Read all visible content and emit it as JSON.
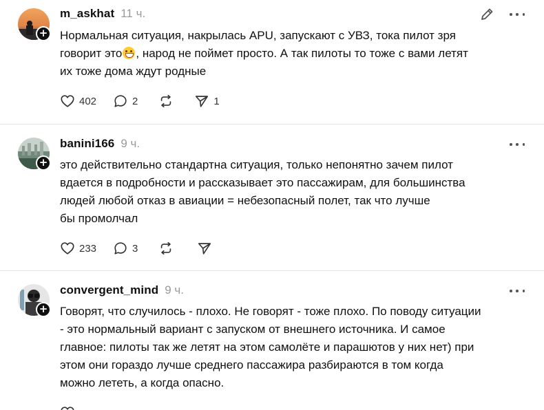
{
  "posts": [
    {
      "username": "m_askhat",
      "time": "11 ч.",
      "lines": [
        "Нормальная ситуация, накрылась APU, запускают с УВЗ, тока пилот зря",
        "говорит это",
        ", народ не поймет просто. А так пилоты то тоже с вами летят",
        "их тоже дома ждут родные"
      ],
      "likes": "402",
      "replies": "2",
      "reposts": "",
      "shares": "1"
    },
    {
      "username": "banini166",
      "time": "9 ч.",
      "lines": [
        "это действительно стандартна ситуация, только непонятно зачем пилот",
        "вдается в подробности и рассказывает это пассажирам, для большинства",
        "людей любой отказ в авиации = небезопасный полет, так что лучше",
        "бы промолчал"
      ],
      "likes": "233",
      "replies": "3",
      "reposts": "",
      "shares": ""
    },
    {
      "username": "convergent_mind",
      "time": "9 ч.",
      "lines": [
        "Говорят, что случилось - плохо. Не говорят - тоже плохо. По поводу ситуации",
        "- это нормальный вариант с запуском от внешнего источника. И самое",
        "главное: пилоты так же летят на этом самолёте и парашютов у них нет) при",
        "этом они гораздо лучше среднего пассажира разбираются в том когда",
        "можно лететь, а когда опасно."
      ]
    }
  ],
  "icons": {
    "follow": "+",
    "like": "heart-icon",
    "reply": "comment-icon",
    "repost": "repost-icon",
    "share": "send-icon",
    "edit": "pencil-icon",
    "more": "more-icon"
  }
}
